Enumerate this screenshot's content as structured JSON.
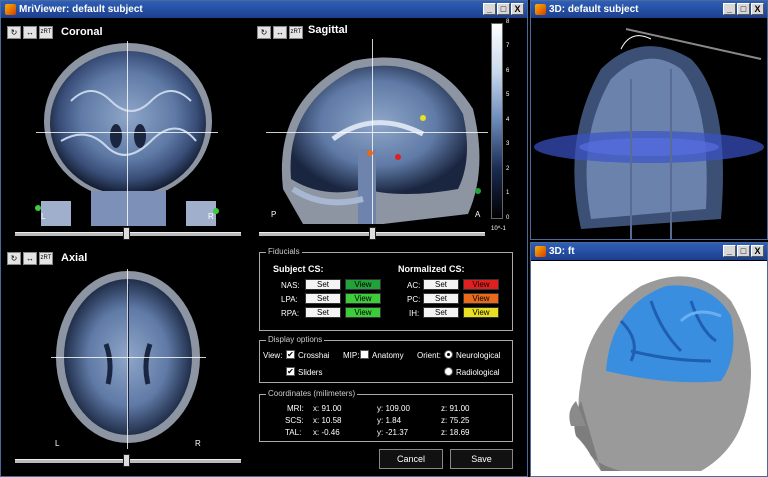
{
  "mri_viewer": {
    "title": "MriViewer: default subject",
    "views": {
      "coronal": {
        "label": "Coronal",
        "left": "L",
        "right": "R"
      },
      "sagittal": {
        "label": "Sagittal",
        "left": "P",
        "right": "A"
      },
      "axial": {
        "label": "Axial",
        "left": "L",
        "right": "R"
      }
    },
    "toolbar": {
      "rotate": "↻",
      "flip": "↔",
      "zoom": "zRT"
    },
    "colorbar": {
      "ticks": [
        "8",
        "7",
        "6",
        "5",
        "4",
        "3",
        "2",
        "1",
        "0"
      ],
      "exponent": "10^-1"
    },
    "fiducials": {
      "title": "Fiducials",
      "subject_cs": {
        "heading": "Subject CS:",
        "rows": [
          {
            "label": "NAS:",
            "set": "Set",
            "view": "View",
            "color": "#22a33a"
          },
          {
            "label": "LPA:",
            "set": "Set",
            "view": "View",
            "color": "#3dcc3a"
          },
          {
            "label": "RPA:",
            "set": "Set",
            "view": "View",
            "color": "#3dcc3a"
          }
        ]
      },
      "normalized_cs": {
        "heading": "Normalized CS:",
        "rows": [
          {
            "label": "AC:",
            "set": "Set",
            "view": "View",
            "color": "#e02020"
          },
          {
            "label": "PC:",
            "set": "Set",
            "view": "View",
            "color": "#e86a1a"
          },
          {
            "label": "IH:",
            "set": "Set",
            "view": "View",
            "color": "#e8e020"
          }
        ]
      }
    },
    "display_options": {
      "title": "Display options",
      "view_label": "View:",
      "crosshair": "Crosshai",
      "sliders": "Sliders",
      "mip_label": "MIP:",
      "anatomy": "Anatomy",
      "orient_label": "Orient:",
      "neurological": "Neurological",
      "radiological": "Radiological",
      "crosshair_checked": true,
      "sliders_checked": true,
      "anatomy_checked": false,
      "orientation_selected": "Neurological"
    },
    "coordinates": {
      "title": "Coordinates (milimeters)",
      "rows": [
        {
          "label": "MRI:",
          "x": "x: 91.00",
          "y": "y: 109.00",
          "z": "z: 91.00"
        },
        {
          "label": "SCS:",
          "x": "x: 10.58",
          "y": "y: 1.84",
          "z": "z: 75.25"
        },
        {
          "label": "TAL:",
          "x": "x: -0.46",
          "y": "y: -21.37",
          "z": "z: 18.69"
        }
      ]
    },
    "buttons": {
      "cancel": "Cancel",
      "save": "Save"
    }
  },
  "view3d_subject": {
    "title": "3D: default subject"
  },
  "view3d_ft": {
    "title": "3D: ft"
  },
  "window_buttons": {
    "minimize": "_",
    "maximize": "□",
    "close": "X"
  },
  "colors": {
    "titlebar": "#2f5fb8",
    "nas_marker": "#22a33a",
    "ac_marker": "#e02020",
    "pc_marker": "#e86a1a",
    "ih_marker": "#e8e020",
    "brain_surface": "#3a8ee0"
  }
}
